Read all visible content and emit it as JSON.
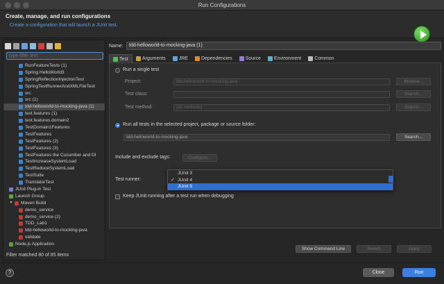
{
  "window": {
    "title": "Run Configurations"
  },
  "banner": {
    "title": "Create, manage, and run configurations",
    "description": "Create a configuration that will launch a JUnit test."
  },
  "left": {
    "filter_placeholder": "type filter text",
    "tree": [
      {
        "label": "RunFeatureTests (1)",
        "icon": "junit",
        "indent": 2
      },
      {
        "label": "Spring HelloWorld3",
        "icon": "junit",
        "indent": 2
      },
      {
        "label": "SpringReflectionInjectionTest",
        "icon": "junit",
        "indent": 2
      },
      {
        "label": "SpringTestRunnerAndXMLFileTest",
        "icon": "junit",
        "indent": 2
      },
      {
        "label": "src",
        "icon": "junit",
        "indent": 2
      },
      {
        "label": "src (1)",
        "icon": "junit",
        "indent": 2
      },
      {
        "label": "tdd-helloworld-to-mocking-java (1)",
        "icon": "junit",
        "indent": 2,
        "selected": true
      },
      {
        "label": "test.features (1)",
        "icon": "junit",
        "indent": 2
      },
      {
        "label": "test.features.domain2",
        "icon": "junit",
        "indent": 2
      },
      {
        "label": "TestDomain1Features",
        "icon": "junit",
        "indent": 2
      },
      {
        "label": "TestFeatures",
        "icon": "junit",
        "indent": 2
      },
      {
        "label": "TestFeatures (2)",
        "icon": "junit",
        "indent": 2
      },
      {
        "label": "TestFeatures (3)",
        "icon": "junit",
        "indent": 2
      },
      {
        "label": "TestFeatures the Cucumber and DI",
        "icon": "junit",
        "indent": 2
      },
      {
        "label": "TestIncreaseSystemLoad",
        "icon": "junit",
        "indent": 2
      },
      {
        "label": "TestReduceSystemLoad",
        "icon": "junit",
        "indent": 2
      },
      {
        "label": "TestSuite",
        "icon": "junit",
        "indent": 2
      },
      {
        "label": "TranslatorTest",
        "icon": "junit",
        "indent": 2
      },
      {
        "label": "JUnit Plug-in Test",
        "icon": "plug",
        "indent": 1
      },
      {
        "label": "Launch Group",
        "icon": "group",
        "indent": 1
      },
      {
        "label": "Maven Build",
        "icon": "maven",
        "indent": 1,
        "expanded": true
      },
      {
        "label": "demo_service",
        "icon": "maven",
        "indent": 2
      },
      {
        "label": "demo_service (2)",
        "icon": "maven",
        "indent": 2
      },
      {
        "label": "TDD_Lab1",
        "icon": "maven",
        "indent": 2
      },
      {
        "label": "tdd-helloworld-to-mocking-java",
        "icon": "maven",
        "indent": 2
      },
      {
        "label": "validate",
        "icon": "maven",
        "indent": 2
      },
      {
        "label": "Node.js Application",
        "icon": "group",
        "indent": 1
      }
    ],
    "filter_status": "Filter matched 80 of 85 items"
  },
  "config": {
    "name_label": "Name:",
    "name_value": "tdd-helloworld-to-mocking-java (1)",
    "tabs": [
      {
        "label": "Test",
        "icon": "test-icon",
        "active": true
      },
      {
        "label": "Arguments",
        "icon": "arguments-icon"
      },
      {
        "label": "JRE",
        "icon": "jre-icon"
      },
      {
        "label": "Dependencies",
        "icon": "dependencies-icon"
      },
      {
        "label": "Source",
        "icon": "source-icon"
      },
      {
        "label": "Environment",
        "icon": "environment-icon"
      },
      {
        "label": "Common",
        "icon": "common-icon"
      }
    ],
    "single_test_label": "Run a single test",
    "project_label": "Project:",
    "project_value": "tdd-helloworld-to-mocking-java",
    "browse_label": "Browse...",
    "test_class_label": "Test class:",
    "search_label": "Search...",
    "test_method_label": "Test method:",
    "test_method_value": "(all methods)",
    "all_tests_label": "Run all tests in the selected project, package or source folder:",
    "all_tests_value": "tdd-helloworld-to-mocking-java",
    "search2_label": "Search...",
    "tags_label": "Include and exclude tags:",
    "configure_label": "Configure...",
    "runner_label": "Test runner:",
    "runner_options": [
      {
        "label": "JUnit 3"
      },
      {
        "label": "JUnit 4",
        "checked": true
      },
      {
        "label": "JUnit 5",
        "highlighted": true
      }
    ],
    "keep_running_label": "Keep JUnit running after a test run when debugging",
    "show_cmd_label": "Show Command Line",
    "revert_label": "Revert",
    "apply_label": "Apply"
  },
  "footer": {
    "help_label": "?",
    "close_label": "Close",
    "run_label": "Run"
  }
}
